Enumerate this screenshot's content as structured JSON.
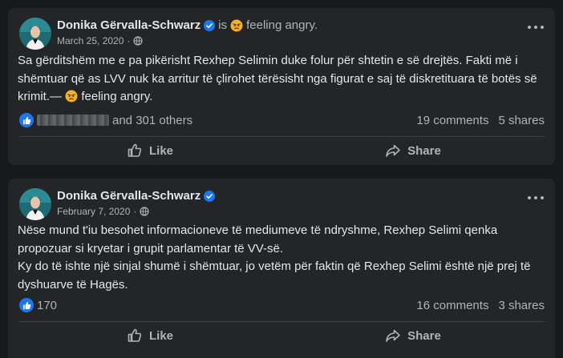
{
  "colors": {
    "page_bg": "#18191a",
    "card_bg": "#242526",
    "primary_text": "#e4e6eb",
    "secondary_text": "#b0b3b8",
    "accent_blue": "#1877f2",
    "angry_emoji": "#f7b125"
  },
  "posts": [
    {
      "author": "Donika Gërvalla-Schwarz",
      "verified_icon": "verified-badge-icon",
      "is_label": "is",
      "feeling_label": "feeling angry.",
      "date": "March 25, 2020",
      "separator": "·",
      "audience_icon": "globe-icon",
      "body_lines": [
        "Sa gërditshëm me e pa pikërisht Rexhep Selimin duke folur për shtetin e së drejtës. Fakti më i",
        "shëmtuar që as LVV nuk ka arritur të çlirohet tërësisht nga figurat e saj të diskretituara të botës së",
        "krimit.—"
      ],
      "body_feeling": "feeling angry.",
      "reactions_text": "and 301 others",
      "comments": "19 comments",
      "shares": "5 shares",
      "like_label": "Like",
      "share_label": "Share"
    },
    {
      "author": "Donika Gërvalla-Schwarz",
      "verified_icon": "verified-badge-icon",
      "date": "February 7, 2020",
      "separator": "·",
      "audience_icon": "globe-icon",
      "body_lines": [
        "Nëse mund t'iu besohet informacioneve të mediumeve të ndryshme, Rexhep Selimi qenka",
        "propozuar si kryetar i grupit parlamentar të VV-së.",
        "Ky do të ishte një sinjal shumë i shëmtuar, jo vetëm për faktin që Rexhep Selimi është një prej të",
        "dyshuarve të Hagës."
      ],
      "reactions_text": "170",
      "comments": "16 comments",
      "shares": "3 shares",
      "like_label": "Like",
      "share_label": "Share"
    }
  ]
}
